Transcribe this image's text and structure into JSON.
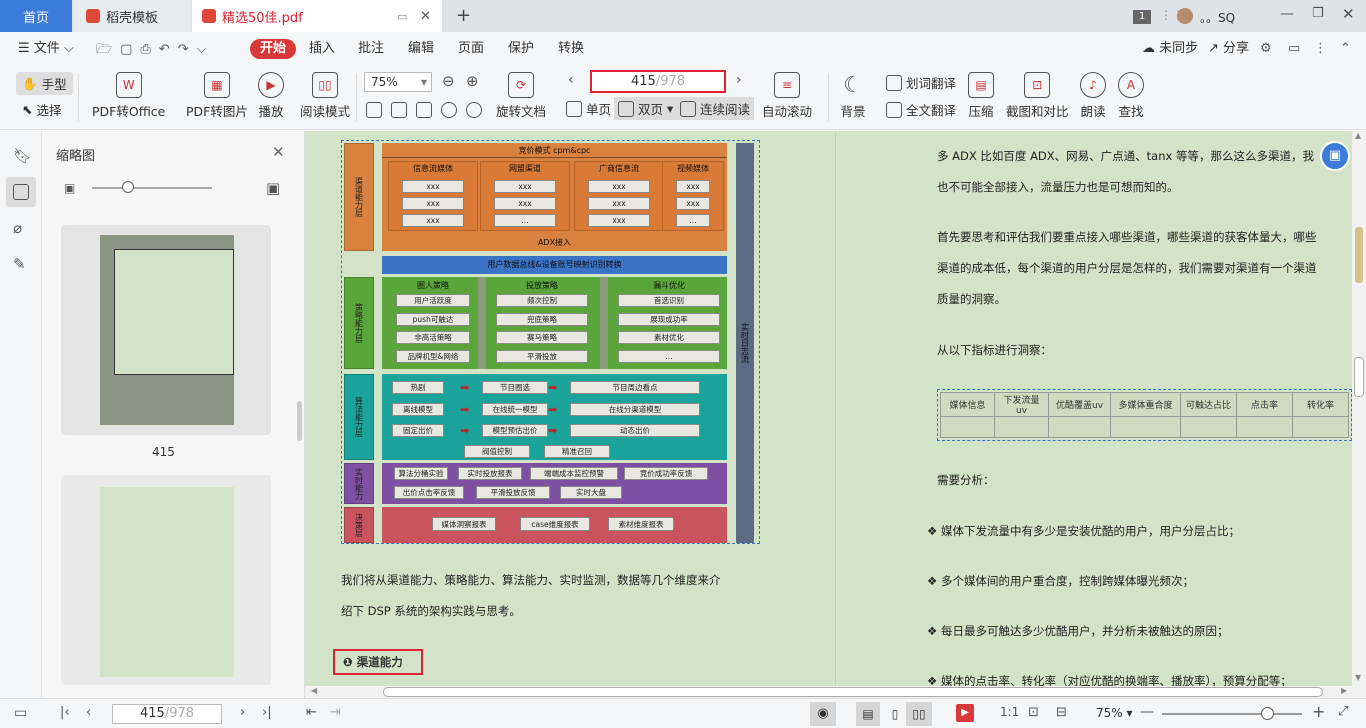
{
  "tabs": {
    "home": "首页",
    "template": "稻壳模板",
    "pdf": "精选50佳.pdf",
    "add": "+"
  },
  "window": {
    "badge": "1",
    "user": "。。SQ"
  },
  "menu": {
    "file": "文件",
    "items": [
      "开始",
      "插入",
      "批注",
      "编辑",
      "页面",
      "保护",
      "转换"
    ],
    "sync": "未同步",
    "share": "分享"
  },
  "toolbar": {
    "hand": "手型",
    "select": "选择",
    "pdf_to_office": "PDF转Office",
    "pdf_to_image": "PDF转图片",
    "play": "播放",
    "read_mode": "阅读模式",
    "zoom": "75%",
    "rotate": "旋转文档",
    "page_current": "415",
    "page_total": "/978",
    "single": "单页",
    "double": "双页",
    "continuous": "连续阅读",
    "auto_scroll": "自动滚动",
    "background": "背景",
    "word_translate": "划词翻译",
    "full_translate": "全文翻译",
    "compress": "压缩",
    "screenshot": "截图和对比",
    "read_aloud": "朗读",
    "find": "查找"
  },
  "thumbnails": {
    "title": "缩略图",
    "page_label": "415",
    "zoom_level": 0.3
  },
  "diagram": {
    "right_label": "实时日志流",
    "channel": {
      "side": "渠道能力层",
      "top": "竞价模式 cpm&cpc",
      "groups": [
        {
          "title": "信息流媒体",
          "items": [
            "xxx",
            "xxx",
            "xxx"
          ]
        },
        {
          "title": "网盟渠道",
          "items": [
            "xxx",
            "xxx",
            "..."
          ]
        },
        {
          "title": "广商信息流",
          "items": [
            "xxx",
            "xxx",
            "xxx"
          ]
        },
        {
          "title": "视频媒体",
          "items": [
            "xxx",
            "xxx",
            "..."
          ]
        }
      ],
      "adx": "ADX接入"
    },
    "mapping": "用户数据总线&设备账号映射识别转换",
    "strategy": {
      "side": "策略能力层",
      "groups": [
        {
          "title": "圈人策略",
          "items": [
            "用户活跃度",
            "push可触达",
            "非高活策略",
            "品牌机型&网络"
          ]
        },
        {
          "title": "投放策略",
          "items": [
            "频次控制",
            "兜底策略",
            "赛马策略",
            "平滑投放"
          ]
        },
        {
          "title": "漏斗优化",
          "items": [
            "首选识别",
            "展现成功率",
            "素材优化",
            "..."
          ]
        }
      ]
    },
    "algorithm": {
      "side": "算法能力层",
      "rows": [
        [
          "热剧",
          "节目圈选",
          "节目周边看点"
        ],
        [
          "离线模型",
          "在线统一模型",
          "在线分渠道模型"
        ],
        [
          "固定出价",
          "模型预估出价",
          "动态出价"
        ]
      ],
      "bottom": [
        "阀值控制",
        "精准召回"
      ]
    },
    "realtime": {
      "side": "实时能力",
      "row1": [
        "算法分桶实验",
        "实时投放报表",
        "端端成本监控预警",
        "竞价成功率反馈"
      ],
      "row2": [
        "出价点击率反馈",
        "平滑投放反馈",
        "实时大盘"
      ]
    },
    "decision": {
      "side": "决策层",
      "items": [
        "媒体洞察报表",
        "case维度报表",
        "素材维度报表"
      ]
    }
  },
  "left_text": {
    "line1": "我们将从渠道能力、策略能力、算法能力、实时监测，数据等几个维度来介",
    "line2": "绍下 DSP  系统的架构实践与思考。",
    "heading_num": "❶",
    "heading": "渠道能力"
  },
  "right_text": {
    "p1a": "多 ADX 比如百度 ADX、网易、广点通、tanx 等等，那么这么多渠道，我",
    "p1b": "也不可能全部接入，流量压力也是可想而知的。",
    "p2a": "首先要思考和评估我们要重点接入哪些渠道，哪些渠道的获客体量大，哪些",
    "p2b": "渠道的成本低，每个渠道的用户分层是怎样的，我们需要对渠道有一个渠道",
    "p2c": "质量的洞察。",
    "p3": "从以下指标进行洞察：",
    "table_headers": [
      "媒体信息",
      "下发流量uv",
      "优酷覆盖uv",
      "多媒体重合度",
      "可触达占比",
      "点击率",
      "转化率"
    ],
    "p4": "需要分析：",
    "bullets": [
      "媒体下发流量中有多少是安装优酷的用户，用户分层占比；",
      "多个媒体间的用户重合度，控制跨媒体曝光频次；",
      "每日最多可触达多少优酷用户，并分析未被触达的原因；",
      "媒体的点击率、转化率（对应优酷的换端率、播放率），预算分配等；"
    ]
  },
  "status": {
    "page_current": "415",
    "page_total": "/978",
    "zoom": "75%",
    "zoom_level": 0.75
  },
  "colors": {
    "channel": "#d9823f",
    "mapping": "#3b74c6",
    "strategy": "#5aa63a",
    "algorithm": "#1aa39a",
    "realtime": "#7e4fa2",
    "decision": "#c9545e",
    "rightbar": "#5a6b83",
    "page_bg": "#d3e3c7",
    "accent_red": "#d9383a"
  }
}
